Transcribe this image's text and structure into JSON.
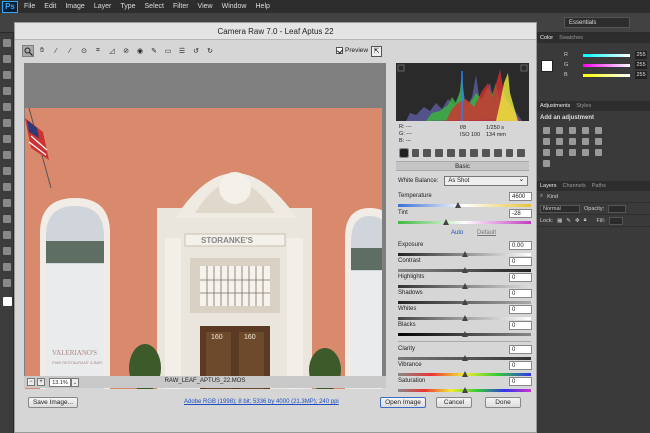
{
  "photoshop": {
    "logo": "Ps",
    "menu": [
      "File",
      "Edit",
      "Image",
      "Layer",
      "Type",
      "Select",
      "Filter",
      "View",
      "Window",
      "Help"
    ],
    "workspace": "Essentials",
    "color_panel": {
      "tabs": [
        "Color",
        "Swatches"
      ],
      "rows": [
        {
          "label": "R",
          "value": "255",
          "color": "#ff0000"
        },
        {
          "label": "G",
          "value": "255",
          "color": "#00ff00"
        },
        {
          "label": "B",
          "value": "255",
          "color": "#0000ff"
        }
      ]
    },
    "adjustments_panel": {
      "tabs": [
        "Adjustments",
        "Styles"
      ],
      "title": "Add an adjustment"
    },
    "layers_panel": {
      "tabs": [
        "Layers",
        "Channels",
        "Paths"
      ],
      "kind": "Kind",
      "blend_mode": "Normal",
      "opacity_label": "Opacity:",
      "lock_label": "Lock:",
      "fill_label": "Fill:"
    }
  },
  "camera_raw": {
    "title": "Camera Raw 7.0  -  Leaf Aptus 22",
    "preview_label": "Preview",
    "zoom_value": "13.1%",
    "filename": "RAW_LEAF_APTUS_22.MOS",
    "readout": {
      "r_label": "R:",
      "g_label": "G:",
      "b_label": "B:",
      "r_value": "---",
      "g_value": "---",
      "b_value": "---",
      "aperture": "f/8",
      "shutter": "1/250 s",
      "iso": "ISO 100",
      "focal": "134 mm"
    },
    "panel_title": "Basic",
    "white_balance": {
      "label": "White Balance:",
      "value": "As Shot"
    },
    "temperature": {
      "label": "Temperature",
      "value": "4600",
      "position": 0.45
    },
    "tint": {
      "label": "Tint",
      "value": "-28",
      "position": 0.36
    },
    "auto_label": "Auto",
    "default_label": "Default",
    "tone_controls": [
      {
        "label": "Exposure",
        "value": "0.00",
        "position": 0.5
      },
      {
        "label": "Contrast",
        "value": "0",
        "position": 0.5
      },
      {
        "label": "Highlights",
        "value": "0",
        "position": 0.5
      },
      {
        "label": "Shadows",
        "value": "0",
        "position": 0.5
      },
      {
        "label": "Whites",
        "value": "0",
        "position": 0.5
      },
      {
        "label": "Blacks",
        "value": "0",
        "position": 0.5
      }
    ],
    "presence_controls": [
      {
        "label": "Clarity",
        "value": "0",
        "position": 0.5
      },
      {
        "label": "Vibrance",
        "value": "0",
        "position": 0.5
      },
      {
        "label": "Saturation",
        "value": "0",
        "position": 0.5
      }
    ],
    "workflow_link": "Adobe RGB (1998); 8 bit; 5336 by 4000 (21.3MP); 240 ppi",
    "buttons": {
      "save": "Save Image...",
      "open": "Open Image",
      "cancel": "Cancel",
      "done": "Done"
    },
    "photo_sign": {
      "storefront": "STORANKE'S",
      "number_left": "160",
      "number_right": "160",
      "window_text_1": "VALERIANO'S",
      "window_text_2": "FINE RESTAURANT & BAR"
    }
  }
}
